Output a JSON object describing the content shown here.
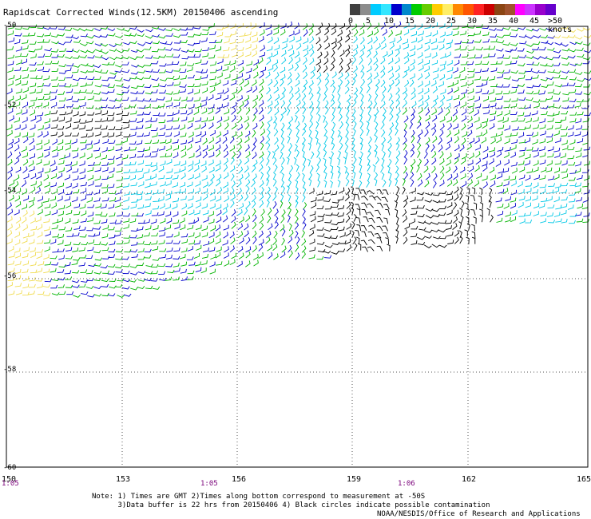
{
  "title": "Rapidscat Corrected Winds(12.5KM) 20150406 ascending",
  "legend": {
    "units": "knots",
    "labels": [
      "0",
      "5",
      "10",
      "15",
      "20",
      "25",
      "30",
      "35",
      "40",
      "45",
      ">50 knots"
    ],
    "colors": [
      "#404040",
      "#8c8c8c",
      "#00ccff",
      "#33e6ff",
      "#0000cc",
      "#0088cc",
      "#00cc00",
      "#66cc00",
      "#ffcc00",
      "#ffee66",
      "#ff8800",
      "#ff5500",
      "#ff2222",
      "#cc0000",
      "#8b4513",
      "#a0522d",
      "#ff00ff",
      "#cc33ff",
      "#9900cc",
      "#6600cc"
    ]
  },
  "axes": {
    "lat_labels": [
      "-50",
      "-52",
      "-54",
      "-56",
      "-58",
      "-60"
    ],
    "lon_labels": [
      "150",
      "153",
      "156",
      "159",
      "162",
      "165"
    ],
    "time_labels": [
      "1:05",
      "1:05",
      "1:06"
    ]
  },
  "notes": [
    "Note: 1) Times are GMT 2)Times along bottom correspond to measurement at -50S",
    "      3)Data buffer is 22 hrs from 20150406 4) Black circles indicate possible contamination"
  ],
  "credit": "NOAA/NESDIS/Office of Research and Applications",
  "wind_colors": {
    "calm": "#000000",
    "light": "#00c8e6",
    "moderate": "#0000cc",
    "fresh": "#00b400",
    "strong": "#f0dc50"
  }
}
